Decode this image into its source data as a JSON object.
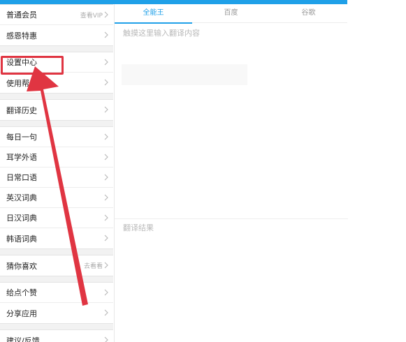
{
  "tabs": [
    {
      "label": "全能王",
      "active": true
    },
    {
      "label": "百度",
      "active": false
    },
    {
      "label": "谷歌",
      "active": false
    }
  ],
  "input": {
    "placeholder": "触摸这里输入翻译内容"
  },
  "result": {
    "label": "翻译结果"
  },
  "sidebar": {
    "groups": [
      {
        "items": [
          {
            "label": "普通会员",
            "hint": "查看VIP"
          },
          {
            "label": "感恩特惠",
            "hint": ""
          }
        ]
      },
      {
        "items": [
          {
            "label": "设置中心",
            "hint": ""
          },
          {
            "label": "使用帮",
            "hint": ""
          }
        ]
      },
      {
        "items": [
          {
            "label": "翻译历史",
            "hint": ""
          }
        ]
      },
      {
        "items": [
          {
            "label": "每日一句",
            "hint": ""
          },
          {
            "label": "耳学外语",
            "hint": ""
          },
          {
            "label": "日常口语",
            "hint": ""
          },
          {
            "label": "英汉词典",
            "hint": ""
          },
          {
            "label": "日汉词典",
            "hint": ""
          },
          {
            "label": "韩语词典",
            "hint": ""
          }
        ]
      },
      {
        "items": [
          {
            "label": "猜你喜欢",
            "hint": "去看看"
          }
        ]
      },
      {
        "items": [
          {
            "label": "给点个赞",
            "hint": ""
          },
          {
            "label": "分享应用",
            "hint": ""
          }
        ]
      },
      {
        "items": [
          {
            "label": "建议/反馈",
            "hint": ""
          }
        ]
      }
    ]
  },
  "colors": {
    "accent": "#1fa0e8",
    "annotation": "#e03542"
  },
  "icons": {
    "chevron": "chevron-right-icon",
    "annotation_arrow": "red-arrow-icon"
  }
}
